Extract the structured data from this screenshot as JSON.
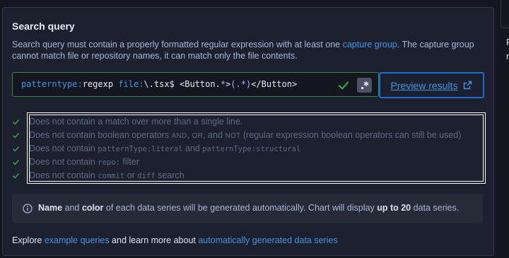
{
  "section": {
    "title": "Search query",
    "desc_1": "Search query must contain a properly formatted regular expression with at least one ",
    "desc_link": "capture group",
    "desc_2": ". The capture group cannot match file or repository names, it can match only the file contents."
  },
  "query": {
    "k_patterntype": "patterntype:",
    "v_patterntype": "regexp",
    "k_file": "file:",
    "v_file": "\\.tsx$",
    "body_1": "<Button.",
    "body_2": "*",
    "body_3": ">",
    "body_4": "(.*)",
    "body_5": "</Button>"
  },
  "preview": {
    "label": "Preview results"
  },
  "rules": [
    {
      "prefix": "Does not contain a match over more than a single line."
    },
    {
      "prefix": "Does not contain boolean operators ",
      "c1": "AND",
      "mid1": ", ",
      "c2": "OR",
      "mid2": ", and ",
      "c3": "NOT",
      "suffix": " (regular expression boolean operators can still be used)"
    },
    {
      "prefix": "Does not contain ",
      "c1": "patternType:literal",
      "mid1": " and ",
      "c2": "patternType:structural"
    },
    {
      "prefix": "Does not contain ",
      "c1": "repo:",
      "suffix": " filter"
    },
    {
      "prefix": "Does not contain ",
      "c1": "commit",
      "mid1": " or ",
      "c2": "diff",
      "suffix": " search"
    }
  ],
  "info": {
    "b1": "Name",
    "t1": " and ",
    "b2": "color",
    "t2": " of each data series will be generated automatically. Chart will display ",
    "b3": "up to 20",
    "t3": " data series."
  },
  "explore": {
    "t1": "Explore ",
    "link1": "example queries",
    "t2": " and learn more about ",
    "link2": "automatically generated data series"
  },
  "side": {
    "frag1": "P",
    "frag2": "r"
  },
  "colors": {
    "accent": "#4393e7",
    "success": "#38a04b",
    "panel": "#1d212f",
    "page": "#14171f"
  },
  "icons": {
    "check": "check-icon",
    "regex": "regex-icon",
    "external": "external-link-icon",
    "info": "info-icon"
  }
}
